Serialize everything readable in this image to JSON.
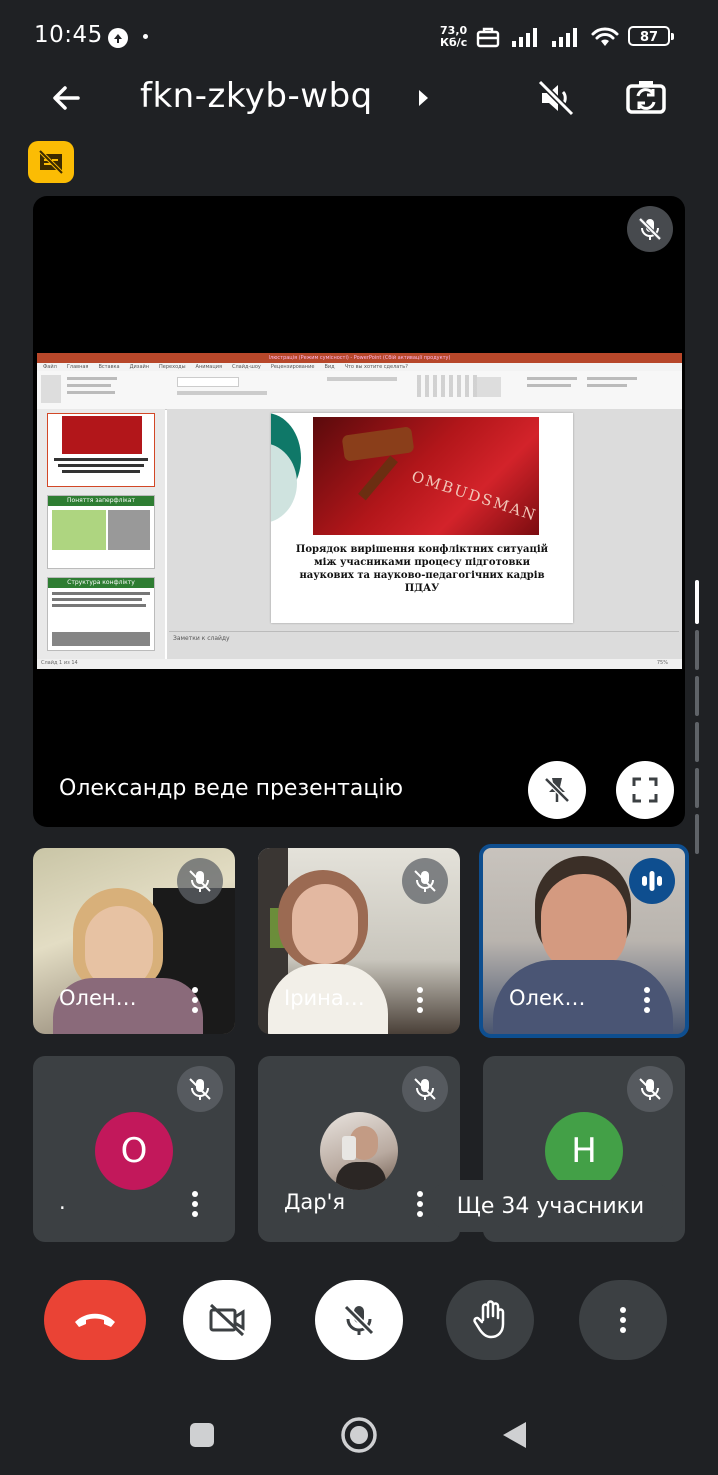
{
  "status_bar": {
    "time": "10:45",
    "net_speed_value": "73,0",
    "net_speed_unit": "Кб/с",
    "battery": "87"
  },
  "header": {
    "meeting_code": "fkn-zkyb-wbq"
  },
  "presentation": {
    "presenter_label": "Олександр веде презентацію",
    "app_title": "Ілюстрація (Режим сумісності) - PowerPoint (Сбій активації продукту)",
    "ribbon_tabs": [
      "Файл",
      "Главная",
      "Вставка",
      "Дизайн",
      "Переходы",
      "Анимация",
      "Слайд-шоу",
      "Рецензирование",
      "Вид",
      "Что вы хотите сделать?"
    ],
    "slide_title": "Порядок вирішення конфліктних ситуацій між учасниками процесу підготовки наукових та науково-педагогічних кадрів ПДАУ",
    "photo_text": "OMBUDSMAN",
    "notes_placeholder": "Заметки к слайду",
    "slide_counter": "Слайд 1 из 14",
    "zoom": "75%",
    "thumb_titles": [
      "Поняття заперфлікат",
      "Структура конфлікту"
    ]
  },
  "participants": [
    {
      "name": "Олен…",
      "muted": true
    },
    {
      "name": "Ірина…",
      "muted": true
    },
    {
      "name": "Олек…",
      "speaking": true
    },
    {
      "name": ".",
      "initial": "О",
      "avatar_color": "#c2185b",
      "muted": true
    },
    {
      "name": "Дар'я",
      "muted": true
    },
    {
      "name": "",
      "initial": "Н",
      "avatar_color": "#43a047",
      "muted": true
    }
  ],
  "more_participants": "Ще 34 учасники",
  "colors": {
    "background": "#1f2124",
    "tile": "#3c4043",
    "end_call": "#ea4335",
    "speaking_border": "#1a73e8"
  }
}
